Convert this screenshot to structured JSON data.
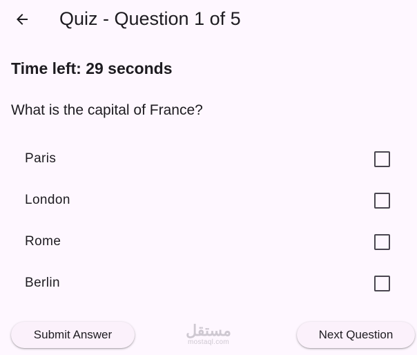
{
  "app_bar": {
    "back_icon": "arrow-back-icon",
    "title": "Quiz - Question 1 of 5"
  },
  "timer": {
    "text": "Time left: 29 seconds"
  },
  "question": {
    "text": "What is the capital of France?"
  },
  "options": [
    {
      "label": "Paris",
      "checked": false
    },
    {
      "label": "London",
      "checked": false
    },
    {
      "label": "Rome",
      "checked": false
    },
    {
      "label": "Berlin",
      "checked": false
    }
  ],
  "buttons": {
    "submit_label": "Submit Answer",
    "next_label": "Next Question"
  },
  "watermark": {
    "logo_text": "مستقل",
    "url_text": "mostaql.com"
  },
  "colors": {
    "background": "#fef7ff",
    "text": "#1d1b20",
    "checkbox_border": "#49454f",
    "button_background": "#fbf1fb"
  }
}
